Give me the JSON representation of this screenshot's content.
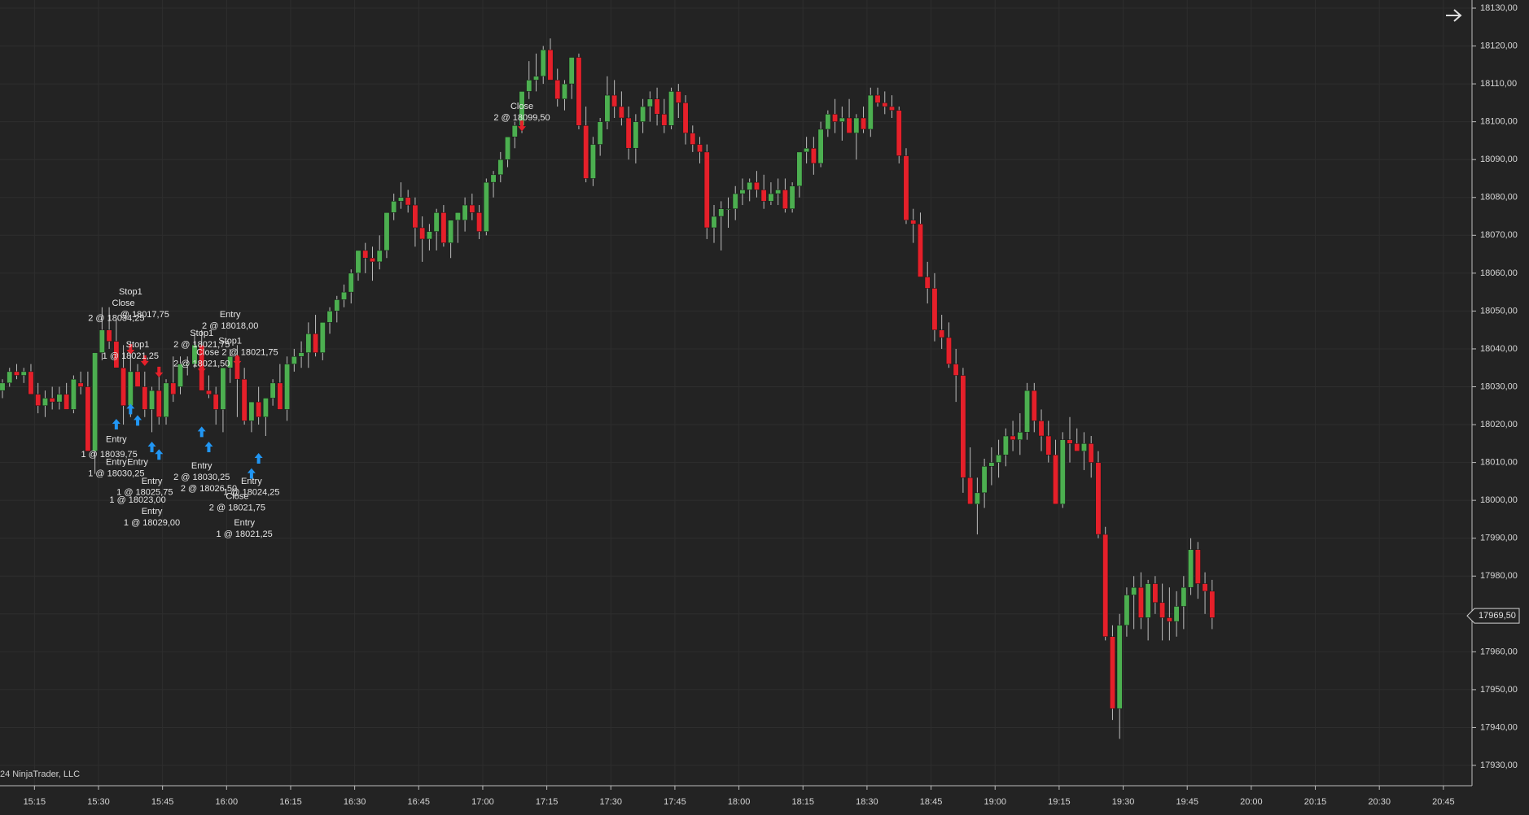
{
  "chart_data": {
    "type": "candlestick",
    "up_color": "#4caf50",
    "down_color": "#e5202a",
    "marker_color_buy": "#2196f3",
    "marker_color_sell": "#e5202a",
    "background": "#232323",
    "grid": true,
    "ylim": [
      17925,
      18130
    ],
    "y_ticks": [
      "18130,00",
      "18120,00",
      "18110,00",
      "18100,00",
      "18090,00",
      "18080,00",
      "18070,00",
      "18060,00",
      "18050,00",
      "18040,00",
      "18030,00",
      "18020,00",
      "18010,00",
      "18000,00",
      "17990,00",
      "17980,00",
      "17970,00",
      "17960,00",
      "17950,00",
      "17940,00",
      "17930,00"
    ],
    "x_ticks": [
      "15:15",
      "15:30",
      "15:45",
      "16:00",
      "16:15",
      "16:30",
      "16:45",
      "17:00",
      "17:15",
      "17:30",
      "17:45",
      "18:00",
      "18:15",
      "18:30",
      "18:45",
      "19:00",
      "19:15",
      "19:30",
      "19:45",
      "20:00",
      "20:15",
      "20:30",
      "20:45"
    ],
    "last_price": "17969,50",
    "copyright": "24 NinjaTrader, LLC",
    "candles": [
      [
        18029,
        18032,
        18027,
        18031
      ],
      [
        18031,
        18035,
        18030,
        18034
      ],
      [
        18034,
        18036,
        18032,
        18033
      ],
      [
        18033,
        18035,
        18031,
        18034
      ],
      [
        18034,
        18036,
        18031,
        18028
      ],
      [
        18028,
        18031,
        18023,
        18025
      ],
      [
        18025,
        18029,
        18022,
        18027
      ],
      [
        18027,
        18030,
        18024,
        18026
      ],
      [
        18026,
        18030,
        18024,
        18028
      ],
      [
        18028,
        18031,
        18026,
        18024
      ],
      [
        18024,
        18033,
        18023,
        18032
      ],
      [
        18031,
        18034,
        18028,
        18030
      ],
      [
        18030,
        18034,
        18026,
        18013
      ],
      [
        18013,
        18030,
        18007,
        18039
      ],
      [
        18039,
        18051,
        18037,
        18045
      ],
      [
        18045,
        18051,
        18040,
        18042
      ],
      [
        18042,
        18048,
        18035,
        18035
      ],
      [
        18035,
        18041,
        18020,
        18025
      ],
      [
        18025,
        18042,
        18022,
        18034
      ],
      [
        18034,
        18036,
        18030,
        18030
      ],
      [
        18030,
        18034,
        18022,
        18024
      ],
      [
        18024,
        18030,
        18018,
        18029
      ],
      [
        18029,
        18033,
        18020,
        18022
      ],
      [
        18022,
        18032,
        18020,
        18031
      ],
      [
        18031,
        18038,
        18026,
        18028
      ],
      [
        18030,
        18038,
        18028,
        18036
      ],
      [
        18036,
        18038,
        18033,
        18036
      ],
      [
        18036,
        18044,
        18035,
        18041
      ],
      [
        18041,
        18045,
        18030,
        18029
      ],
      [
        18029,
        18033,
        18027,
        18028
      ],
      [
        18028,
        18030,
        18020,
        18024
      ],
      [
        18024,
        18034,
        18018,
        18035
      ],
      [
        18035,
        18040,
        18031,
        18038
      ],
      [
        18038,
        18041,
        18022,
        18032
      ],
      [
        18032,
        18035,
        18020,
        18021
      ],
      [
        18021,
        18024,
        18018,
        18026
      ],
      [
        18026,
        18030,
        18020,
        18022
      ],
      [
        18022,
        18027,
        18017,
        18027
      ],
      [
        18027,
        18032,
        18025,
        18031
      ],
      [
        18031,
        18036,
        18029,
        18024
      ],
      [
        18024,
        18038,
        18021,
        18036
      ],
      [
        18036,
        18040,
        18034,
        18038
      ],
      [
        18038,
        18042,
        18035,
        18039
      ],
      [
        18039,
        18047,
        18035,
        18044
      ],
      [
        18044,
        18049,
        18038,
        18039
      ],
      [
        18039,
        18047,
        18037,
        18047
      ],
      [
        18047,
        18051,
        18044,
        18050
      ],
      [
        18050,
        18054,
        18047,
        18053
      ],
      [
        18053,
        18057,
        18051,
        18055
      ],
      [
        18055,
        18061,
        18052,
        18060
      ],
      [
        18060,
        18066,
        18058,
        18066
      ],
      [
        18066,
        18068,
        18060,
        18064
      ],
      [
        18064,
        18067,
        18058,
        18063
      ],
      [
        18063,
        18070,
        18061,
        18066
      ],
      [
        18066,
        18076,
        18064,
        18076
      ],
      [
        18076,
        18081,
        18074,
        18079
      ],
      [
        18079,
        18084,
        18077,
        18080
      ],
      [
        18080,
        18082,
        18076,
        18078
      ],
      [
        18078,
        18080,
        18067,
        18072
      ],
      [
        18072,
        18075,
        18063,
        18069
      ],
      [
        18069,
        18073,
        18066,
        18071
      ],
      [
        18071,
        18077,
        18066,
        18076
      ],
      [
        18076,
        18078,
        18067,
        18068
      ],
      [
        18068,
        18073,
        18064,
        18074
      ],
      [
        18074,
        18076,
        18068,
        18076
      ],
      [
        18074,
        18080,
        18071,
        18078
      ],
      [
        18078,
        18081,
        18074,
        18076
      ],
      [
        18076,
        18078,
        18069,
        18071
      ],
      [
        18071,
        18085,
        18070,
        18084
      ],
      [
        18084,
        18087,
        18080,
        18086
      ],
      [
        18086,
        18092,
        18084,
        18090
      ],
      [
        18090,
        18095,
        18088,
        18096
      ],
      [
        18096,
        18100,
        18093,
        18099
      ],
      [
        18099,
        18107,
        18097,
        18108
      ],
      [
        18108,
        18116,
        18106,
        18111
      ],
      [
        18111,
        18118,
        18108,
        18112
      ],
      [
        18112,
        18120,
        18110,
        18119
      ],
      [
        18119,
        18122,
        18112,
        18111
      ],
      [
        18111,
        18114,
        18104,
        18106
      ],
      [
        18106,
        18111,
        18103,
        18110
      ],
      [
        18110,
        18116,
        18106,
        18117
      ],
      [
        18117,
        18118,
        18098,
        18099
      ],
      [
        18099,
        18104,
        18084,
        18085
      ],
      [
        18085,
        18096,
        18083,
        18094
      ],
      [
        18094,
        18101,
        18091,
        18100
      ],
      [
        18100,
        18112,
        18098,
        18107
      ],
      [
        18107,
        18111,
        18101,
        18104
      ],
      [
        18104,
        18108,
        18099,
        18101
      ],
      [
        18101,
        18104,
        18090,
        18093
      ],
      [
        18093,
        18102,
        18089,
        18100
      ],
      [
        18100,
        18106,
        18097,
        18104
      ],
      [
        18104,
        18108,
        18100,
        18106
      ],
      [
        18106,
        18109,
        18099,
        18102
      ],
      [
        18102,
        18106,
        18097,
        18099
      ],
      [
        18099,
        18109,
        18098,
        18108
      ],
      [
        18108,
        18110,
        18101,
        18105
      ],
      [
        18105,
        18107,
        18094,
        18097
      ],
      [
        18097,
        18099,
        18092,
        18094
      ],
      [
        18094,
        18096,
        18089,
        18092
      ],
      [
        18092,
        18094,
        18069,
        18072
      ],
      [
        18072,
        18078,
        18068,
        18075
      ],
      [
        18075,
        18079,
        18066,
        18077
      ],
      [
        18077,
        18080,
        18072,
        18077
      ],
      [
        18077,
        18083,
        18074,
        18081
      ],
      [
        18081,
        18085,
        18078,
        18082
      ],
      [
        18082,
        18085,
        18079,
        18084
      ],
      [
        18084,
        18087,
        18080,
        18082
      ],
      [
        18082,
        18086,
        18077,
        18079
      ],
      [
        18079,
        18084,
        18078,
        18081
      ],
      [
        18081,
        18085,
        18078,
        18082
      ],
      [
        18082,
        18085,
        18076,
        18077
      ],
      [
        18077,
        18084,
        18076,
        18083
      ],
      [
        18083,
        18092,
        18080,
        18092
      ],
      [
        18092,
        18096,
        18089,
        18093
      ],
      [
        18093,
        18096,
        18086,
        18089
      ],
      [
        18089,
        18100,
        18088,
        18098
      ],
      [
        18098,
        18103,
        18096,
        18102
      ],
      [
        18102,
        18106,
        18097,
        18100
      ],
      [
        18100,
        18104,
        18095,
        18101
      ],
      [
        18101,
        18106,
        18097,
        18097
      ],
      [
        18097,
        18102,
        18090,
        18101
      ],
      [
        18101,
        18104,
        18097,
        18098
      ],
      [
        18098,
        18109,
        18096,
        18107
      ],
      [
        18107,
        18109,
        18104,
        18105
      ],
      [
        18105,
        18108,
        18102,
        18104
      ],
      [
        18104,
        18107,
        18101,
        18103
      ],
      [
        18103,
        18104,
        18089,
        18091
      ],
      [
        18091,
        18093,
        18073,
        18074
      ],
      [
        18074,
        18077,
        18068,
        18073
      ],
      [
        18073,
        18076,
        18059,
        18059
      ],
      [
        18059,
        18063,
        18052,
        18056
      ],
      [
        18056,
        18060,
        18042,
        18045
      ],
      [
        18045,
        18049,
        18040,
        18043
      ],
      [
        18043,
        18047,
        18035,
        18036
      ],
      [
        18036,
        18040,
        18026,
        18033
      ],
      [
        18033,
        18035,
        18002,
        18006
      ],
      [
        18006,
        18014,
        17999,
        17999
      ],
      [
        17999,
        18006,
        17991,
        18002
      ],
      [
        18002,
        18011,
        17998,
        18009
      ],
      [
        18009,
        18014,
        18004,
        18010
      ],
      [
        18010,
        18016,
        18006,
        18012
      ],
      [
        18012,
        18019,
        18009,
        18017
      ],
      [
        18017,
        18021,
        18013,
        18016
      ],
      [
        18016,
        18023,
        18012,
        18018
      ],
      [
        18018,
        18031,
        18016,
        18029
      ],
      [
        18029,
        18031,
        18018,
        18021
      ],
      [
        18021,
        18024,
        18013,
        18017
      ],
      [
        18017,
        18021,
        18010,
        18012
      ],
      [
        18012,
        18016,
        17999,
        17999
      ],
      [
        17999,
        18018,
        17998,
        18016
      ],
      [
        18016,
        18022,
        18010,
        18015
      ],
      [
        18015,
        18019,
        18013,
        18013
      ],
      [
        18013,
        18018,
        18008,
        18015
      ],
      [
        18015,
        18017,
        18006,
        18010
      ],
      [
        18010,
        18013,
        17990,
        17991
      ],
      [
        17991,
        17993,
        17963,
        17964
      ],
      [
        17964,
        17967,
        17942,
        17945
      ],
      [
        17945,
        17970,
        17937,
        17967
      ],
      [
        17967,
        17977,
        17964,
        17975
      ],
      [
        17975,
        17980,
        17966,
        17977
      ],
      [
        17977,
        17981,
        17966,
        17969
      ],
      [
        17969,
        17979,
        17963,
        17978
      ],
      [
        17978,
        17980,
        17970,
        17973
      ],
      [
        17973,
        17978,
        17963,
        17969
      ],
      [
        17969,
        17977,
        17963,
        17968
      ],
      [
        17968,
        17976,
        17964,
        17972
      ],
      [
        17972,
        17980,
        17966,
        17977
      ],
      [
        17977,
        17990,
        17975,
        17987
      ],
      [
        17987,
        17989,
        17974,
        17978
      ],
      [
        17978,
        17981,
        17970,
        17976
      ],
      [
        17976,
        17979,
        17966,
        17969
      ]
    ],
    "annotations": [
      {
        "i": 18,
        "price": 18055,
        "lines": [
          "Stop1"
        ]
      },
      {
        "i": 17,
        "price": 18052,
        "lines": [
          "Close"
        ]
      },
      {
        "i": 16,
        "price": 18048,
        "lines": [
          "2 @ 18034,25"
        ]
      },
      {
        "i": 20,
        "price": 18049,
        "lines": [
          "@ 18017,75"
        ]
      },
      {
        "i": 19,
        "price": 18041,
        "lines": [
          "Stop1"
        ]
      },
      {
        "i": 18,
        "price": 18038,
        "lines": [
          "1 @ 18021,25"
        ]
      },
      {
        "i": 16,
        "price": 18016,
        "lines": [
          "Entry"
        ]
      },
      {
        "i": 15,
        "price": 18012,
        "lines": [
          "1 @ 18039,75"
        ]
      },
      {
        "i": 16,
        "price": 18010,
        "lines": [
          "Entry"
        ]
      },
      {
        "i": 19,
        "price": 18010,
        "lines": [
          "Entry"
        ]
      },
      {
        "i": 16,
        "price": 18007,
        "lines": [
          "1 @ 18030,25"
        ]
      },
      {
        "i": 21,
        "price": 18005,
        "lines": [
          "Entry"
        ]
      },
      {
        "i": 20,
        "price": 18002,
        "lines": [
          "1 @ 18025,75"
        ]
      },
      {
        "i": 19,
        "price": 18000,
        "lines": [
          "1 @ 18023,00"
        ]
      },
      {
        "i": 21,
        "price": 17997,
        "lines": [
          "Entry"
        ]
      },
      {
        "i": 21,
        "price": 17994,
        "lines": [
          "1 @ 18029,00"
        ]
      },
      {
        "i": 32,
        "price": 18049,
        "lines": [
          "Entry"
        ]
      },
      {
        "i": 32,
        "price": 18046,
        "lines": [
          "2 @ 18018,00"
        ]
      },
      {
        "i": 28,
        "price": 18044,
        "lines": [
          "Stop1"
        ]
      },
      {
        "i": 28,
        "price": 18041,
        "lines": [
          "2 @ 18021,75"
        ]
      },
      {
        "i": 32,
        "price": 18042,
        "lines": [
          "Stop1"
        ]
      },
      {
        "i": 33,
        "price": 18039,
        "lines": [
          "Close 2 @ 18021,75"
        ]
      },
      {
        "i": 28,
        "price": 18036,
        "lines": [
          "2 @ 18021,50"
        ]
      },
      {
        "i": 28,
        "price": 18009,
        "lines": [
          "Entry"
        ]
      },
      {
        "i": 28,
        "price": 18006,
        "lines": [
          "2 @ 18030,25"
        ]
      },
      {
        "i": 29,
        "price": 18003,
        "lines": [
          "2 @ 18026,50"
        ]
      },
      {
        "i": 35,
        "price": 18005,
        "lines": [
          "Entry"
        ]
      },
      {
        "i": 35,
        "price": 18002,
        "lines": [
          "1 @ 18024,25"
        ]
      },
      {
        "i": 33,
        "price": 18001,
        "lines": [
          "Close"
        ]
      },
      {
        "i": 33,
        "price": 17998,
        "lines": [
          "2 @ 18021,75"
        ]
      },
      {
        "i": 34,
        "price": 17994,
        "lines": [
          "Entry"
        ]
      },
      {
        "i": 34,
        "price": 17991,
        "lines": [
          "1 @ 18021,25"
        ]
      },
      {
        "i": 73,
        "price": 18104,
        "lines": [
          "Close"
        ]
      },
      {
        "i": 73,
        "price": 18101,
        "lines": [
          "2 @ 18099,50"
        ]
      }
    ],
    "markers": [
      {
        "i": 16,
        "price": 18020,
        "dir": "up"
      },
      {
        "i": 18,
        "price": 18024,
        "dir": "up"
      },
      {
        "i": 19,
        "price": 18021,
        "dir": "up"
      },
      {
        "i": 21,
        "price": 18014,
        "dir": "up"
      },
      {
        "i": 22,
        "price": 18012,
        "dir": "up"
      },
      {
        "i": 18,
        "price": 18040,
        "dir": "down"
      },
      {
        "i": 20,
        "price": 18037,
        "dir": "down"
      },
      {
        "i": 22,
        "price": 18034,
        "dir": "down"
      },
      {
        "i": 28,
        "price": 18018,
        "dir": "up"
      },
      {
        "i": 29,
        "price": 18014,
        "dir": "up"
      },
      {
        "i": 28,
        "price": 18035,
        "dir": "down"
      },
      {
        "i": 33,
        "price": 18037,
        "dir": "down"
      },
      {
        "i": 35,
        "price": 18007,
        "dir": "up"
      },
      {
        "i": 36,
        "price": 18011,
        "dir": "up"
      },
      {
        "i": 73,
        "price": 18099,
        "dir": "down"
      }
    ]
  }
}
